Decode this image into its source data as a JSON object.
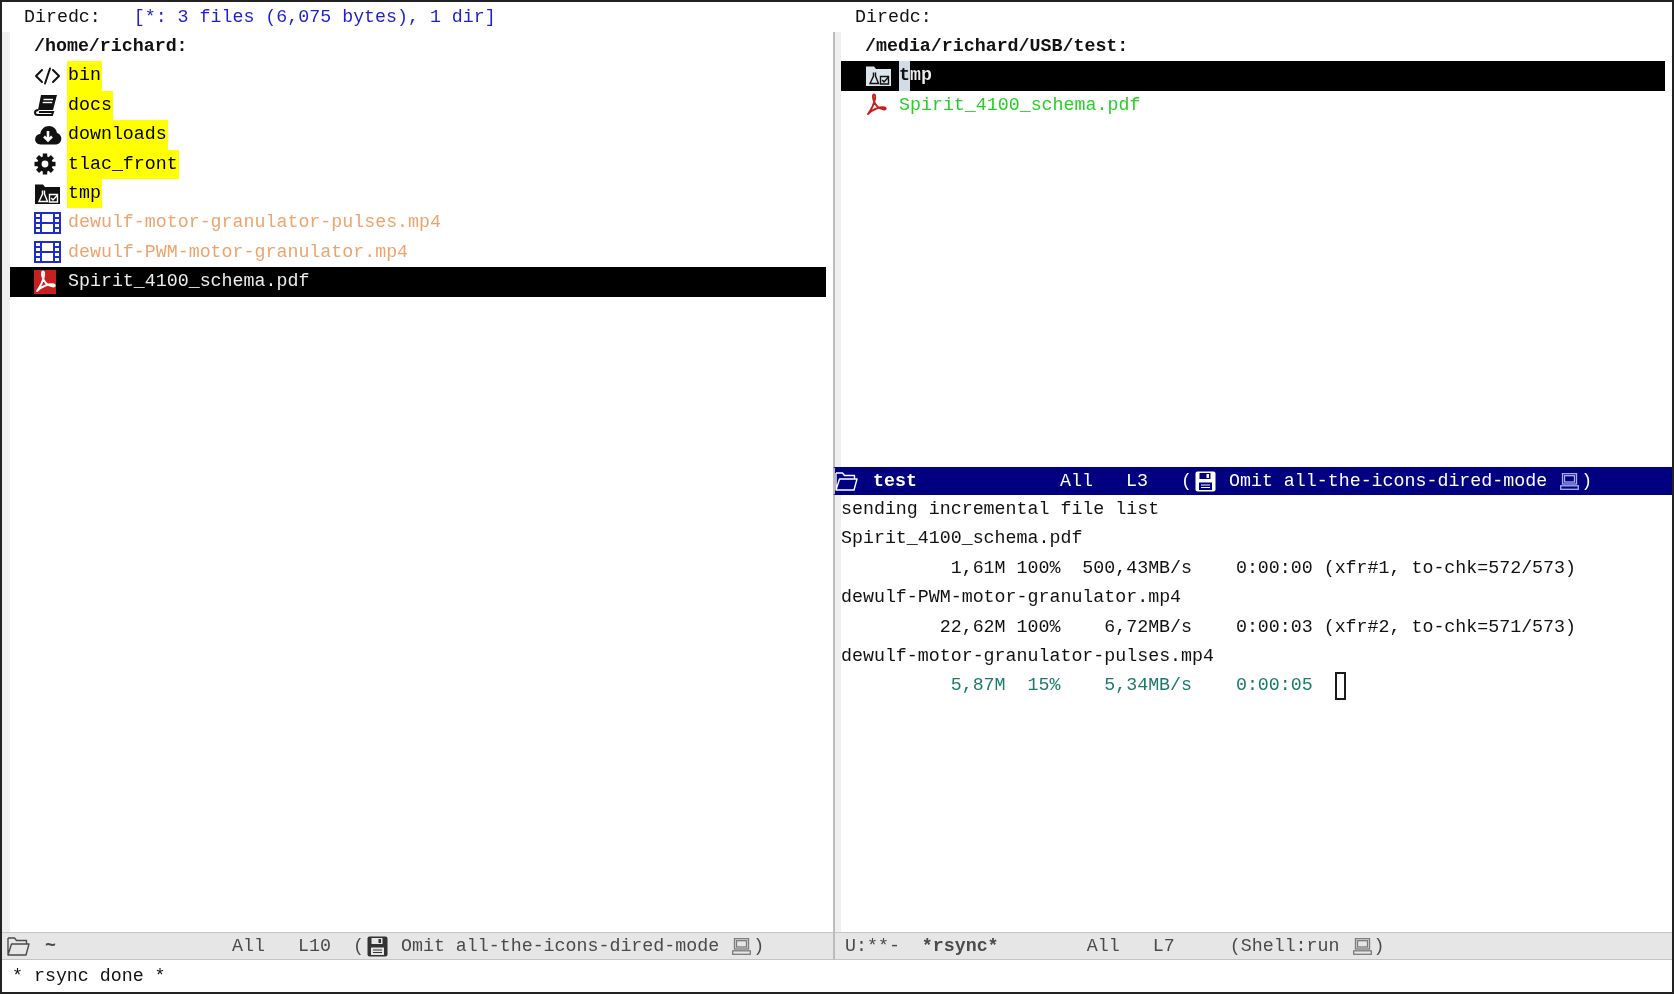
{
  "columns": [
    {
      "windows": [
        {
          "kind": "dired",
          "focused": false,
          "header": {
            "label": "Diredc:",
            "summary": "[*: 3 files (6,075 bytes), 1 dir]"
          },
          "directory": "/home/richard:",
          "entries": [
            {
              "name": "bin",
              "kind": "code",
              "selected": false
            },
            {
              "name": "docs",
              "kind": "book",
              "selected": false
            },
            {
              "name": "downloads",
              "kind": "download",
              "selected": false
            },
            {
              "name": "tlac_front",
              "kind": "gear",
              "selected": false
            },
            {
              "name": "tmp",
              "kind": "lab",
              "selected": false
            },
            {
              "name": "dewulf-motor-granulator-pulses.mp4",
              "kind": "film",
              "selected": false
            },
            {
              "name": "dewulf-PWM-motor-granulator.mp4",
              "kind": "film",
              "selected": false
            },
            {
              "name": "Spirit_4100_schema.pdf",
              "kind": "pdf",
              "selected": true
            }
          ],
          "mode_line": {
            "buffer": "~",
            "position": "All",
            "line": "L10",
            "mode": {
              "prefix": "(",
              "name": "Omit all-the-icons-dired-mode",
              "suffix": ")"
            }
          }
        }
      ]
    },
    {
      "windows": [
        {
          "kind": "dired",
          "focused": true,
          "header": {
            "label": "Diredc:"
          },
          "directory": "/media/richard/USB/test:",
          "entries": [
            {
              "name": "tmp",
              "kind": "lab",
              "selected": true
            },
            {
              "name": "Spirit_4100_schema.pdf",
              "kind": "pdf",
              "selected": false
            }
          ],
          "mode_line": {
            "buffer": "test",
            "position": "All",
            "line": "L3",
            "mode": {
              "prefix": "(",
              "name": "Omit all-the-icons-dired-mode",
              "suffix": ")"
            }
          }
        },
        {
          "kind": "shell",
          "focused": false,
          "lines": [
            {
              "kind": "text",
              "text": "sending incremental file list",
              "current": false,
              "cursor": false
            },
            {
              "kind": "text",
              "text": "Spirit_4100_schema.pdf",
              "current": false,
              "cursor": false
            },
            {
              "kind": "progress",
              "size": "1,61M",
              "percent": "100%",
              "speed": "500,43MB/s",
              "elapsed": "0:00:00",
              "info": "(xfr#1, to-chk=572/573)",
              "current": false,
              "cursor": false
            },
            {
              "kind": "text",
              "text": "dewulf-PWM-motor-granulator.mp4",
              "current": false,
              "cursor": false
            },
            {
              "kind": "progress",
              "size": "22,62M",
              "percent": "100%",
              "speed": "6,72MB/s",
              "elapsed": "0:00:03",
              "info": "(xfr#2, to-chk=571/573)",
              "current": false,
              "cursor": false
            },
            {
              "kind": "text",
              "text": "dewulf-motor-granulator-pulses.mp4",
              "current": false,
              "cursor": false
            },
            {
              "kind": "progress",
              "size": "5,87M",
              "percent": "15%",
              "speed": "5,34MB/s",
              "elapsed": "0:00:05",
              "current": true,
              "cursor": true
            }
          ],
          "mode_line": {
            "status": "U:**-",
            "buffer": "*rsync*",
            "position": "All",
            "line": "L7",
            "mode": {
              "name": "(Shell:run",
              "suffix": ")"
            }
          }
        }
      ]
    }
  ],
  "echo_area": "* rsync done *"
}
